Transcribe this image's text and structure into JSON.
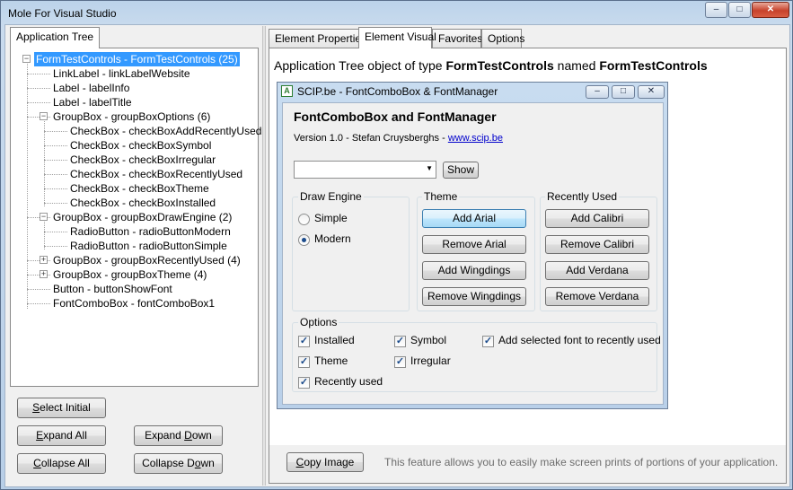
{
  "window": {
    "title": "Mole For Visual Studio",
    "caption_buttons": {
      "minimize": "‒",
      "maximize": "□",
      "close": "✕"
    }
  },
  "left_panel": {
    "tab": "Application Tree",
    "tree": [
      {
        "label": "FormTestControls - FormTestControls (25)",
        "selected": true,
        "expander": "−"
      },
      {
        "label": "LinkLabel - linkLabelWebsite"
      },
      {
        "label": "Label - labelInfo"
      },
      {
        "label": "Label - labelTitle"
      },
      {
        "label": "GroupBox - groupBoxOptions (6)",
        "expander": "−"
      },
      {
        "label": "CheckBox - checkBoxAddRecentlyUsed"
      },
      {
        "label": "CheckBox - checkBoxSymbol"
      },
      {
        "label": "CheckBox - checkBoxIrregular"
      },
      {
        "label": "CheckBox - checkBoxRecentlyUsed"
      },
      {
        "label": "CheckBox - checkBoxTheme"
      },
      {
        "label": "CheckBox - checkBoxInstalled"
      },
      {
        "label": "GroupBox - groupBoxDrawEngine (2)",
        "expander": "−"
      },
      {
        "label": "RadioButton - radioButtonModern"
      },
      {
        "label": "RadioButton - radioButtonSimple"
      },
      {
        "label": "GroupBox - groupBoxRecentlyUsed (4)",
        "expander": "+"
      },
      {
        "label": "GroupBox - groupBoxTheme (4)",
        "expander": "+"
      },
      {
        "label": "Button - buttonShowFont"
      },
      {
        "label": "FontComboBox - fontComboBox1"
      }
    ],
    "buttons": {
      "select_initial_u": "S",
      "select_initial_rest": "elect Initial",
      "expand_all_u": "E",
      "expand_all_rest": "xpand All",
      "expand_down_pre": "Expand ",
      "expand_down_u": "D",
      "expand_down_rest": "own",
      "collapse_all_u": "C",
      "collapse_all_rest": "ollapse All",
      "collapse_down_pre": "Collapse D",
      "collapse_down_u": "o",
      "collapse_down_rest": "wn"
    }
  },
  "right_panel": {
    "tabs": [
      "Element Properties",
      "Element Visual",
      "Favorites",
      "Options"
    ],
    "active_tab": "Element Visual",
    "heading": {
      "prefix": "Application Tree object of type ",
      "type": "FormTestControls",
      "middle": " named ",
      "name": "FormTestControls"
    },
    "copy_image_button_u": "C",
    "copy_image_button_rest": "opy Image",
    "info_text": "This feature allows you to easily make screen prints of portions of your application."
  },
  "preview": {
    "window_title": "SCIP.be - FontComboBox & FontManager",
    "app_icon": "A",
    "heading": "FontComboBox and FontManager",
    "version_text": "Version 1.0 - Stefan Cruysberghs - ",
    "website_link": "www.scip.be",
    "font_combo_value": "",
    "show_button": "Show",
    "draw_engine": {
      "title": "Draw Engine",
      "options": [
        {
          "label": "Simple",
          "checked": false
        },
        {
          "label": "Modern",
          "checked": true
        }
      ]
    },
    "theme": {
      "title": "Theme",
      "buttons": [
        "Add Arial",
        "Remove Arial",
        "Add Wingdings",
        "Remove Wingdings"
      ]
    },
    "recently_used": {
      "title": "Recently Used",
      "buttons": [
        "Add Calibri",
        "Remove Calibri",
        "Add Verdana",
        "Remove Verdana"
      ]
    },
    "options": {
      "title": "Options",
      "checkboxes": [
        {
          "label": "Installed",
          "checked": true
        },
        {
          "label": "Theme",
          "checked": true
        },
        {
          "label": "Recently used",
          "checked": true
        },
        {
          "label": "Symbol",
          "checked": true
        },
        {
          "label": "Irregular",
          "checked": true
        },
        {
          "label": "Add selected font to recently used",
          "checked": true
        }
      ]
    }
  },
  "colors": {
    "selection": "#3399ff",
    "link": "#0000cc",
    "hint_text": "#6d6d6d"
  }
}
